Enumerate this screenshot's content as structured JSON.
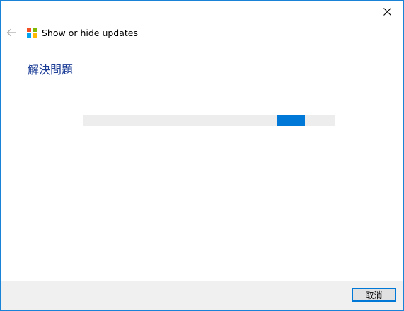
{
  "window": {
    "accent_color": "#1883d7"
  },
  "titlebar": {
    "close_icon": "close-icon",
    "back_icon": "back-arrow-icon"
  },
  "header": {
    "app_icon": "windows-logo-icon",
    "logo_colors": [
      "#f25022",
      "#7fba00",
      "#00a4ef",
      "#ffb900"
    ],
    "app_title": "Show or hide updates"
  },
  "main": {
    "heading": "解決問題",
    "heading_color": "#1e3f98",
    "progress": {
      "type": "indeterminate",
      "color": "#0078d7",
      "track_color": "#ededed"
    }
  },
  "footer": {
    "cancel_label": "取消"
  }
}
